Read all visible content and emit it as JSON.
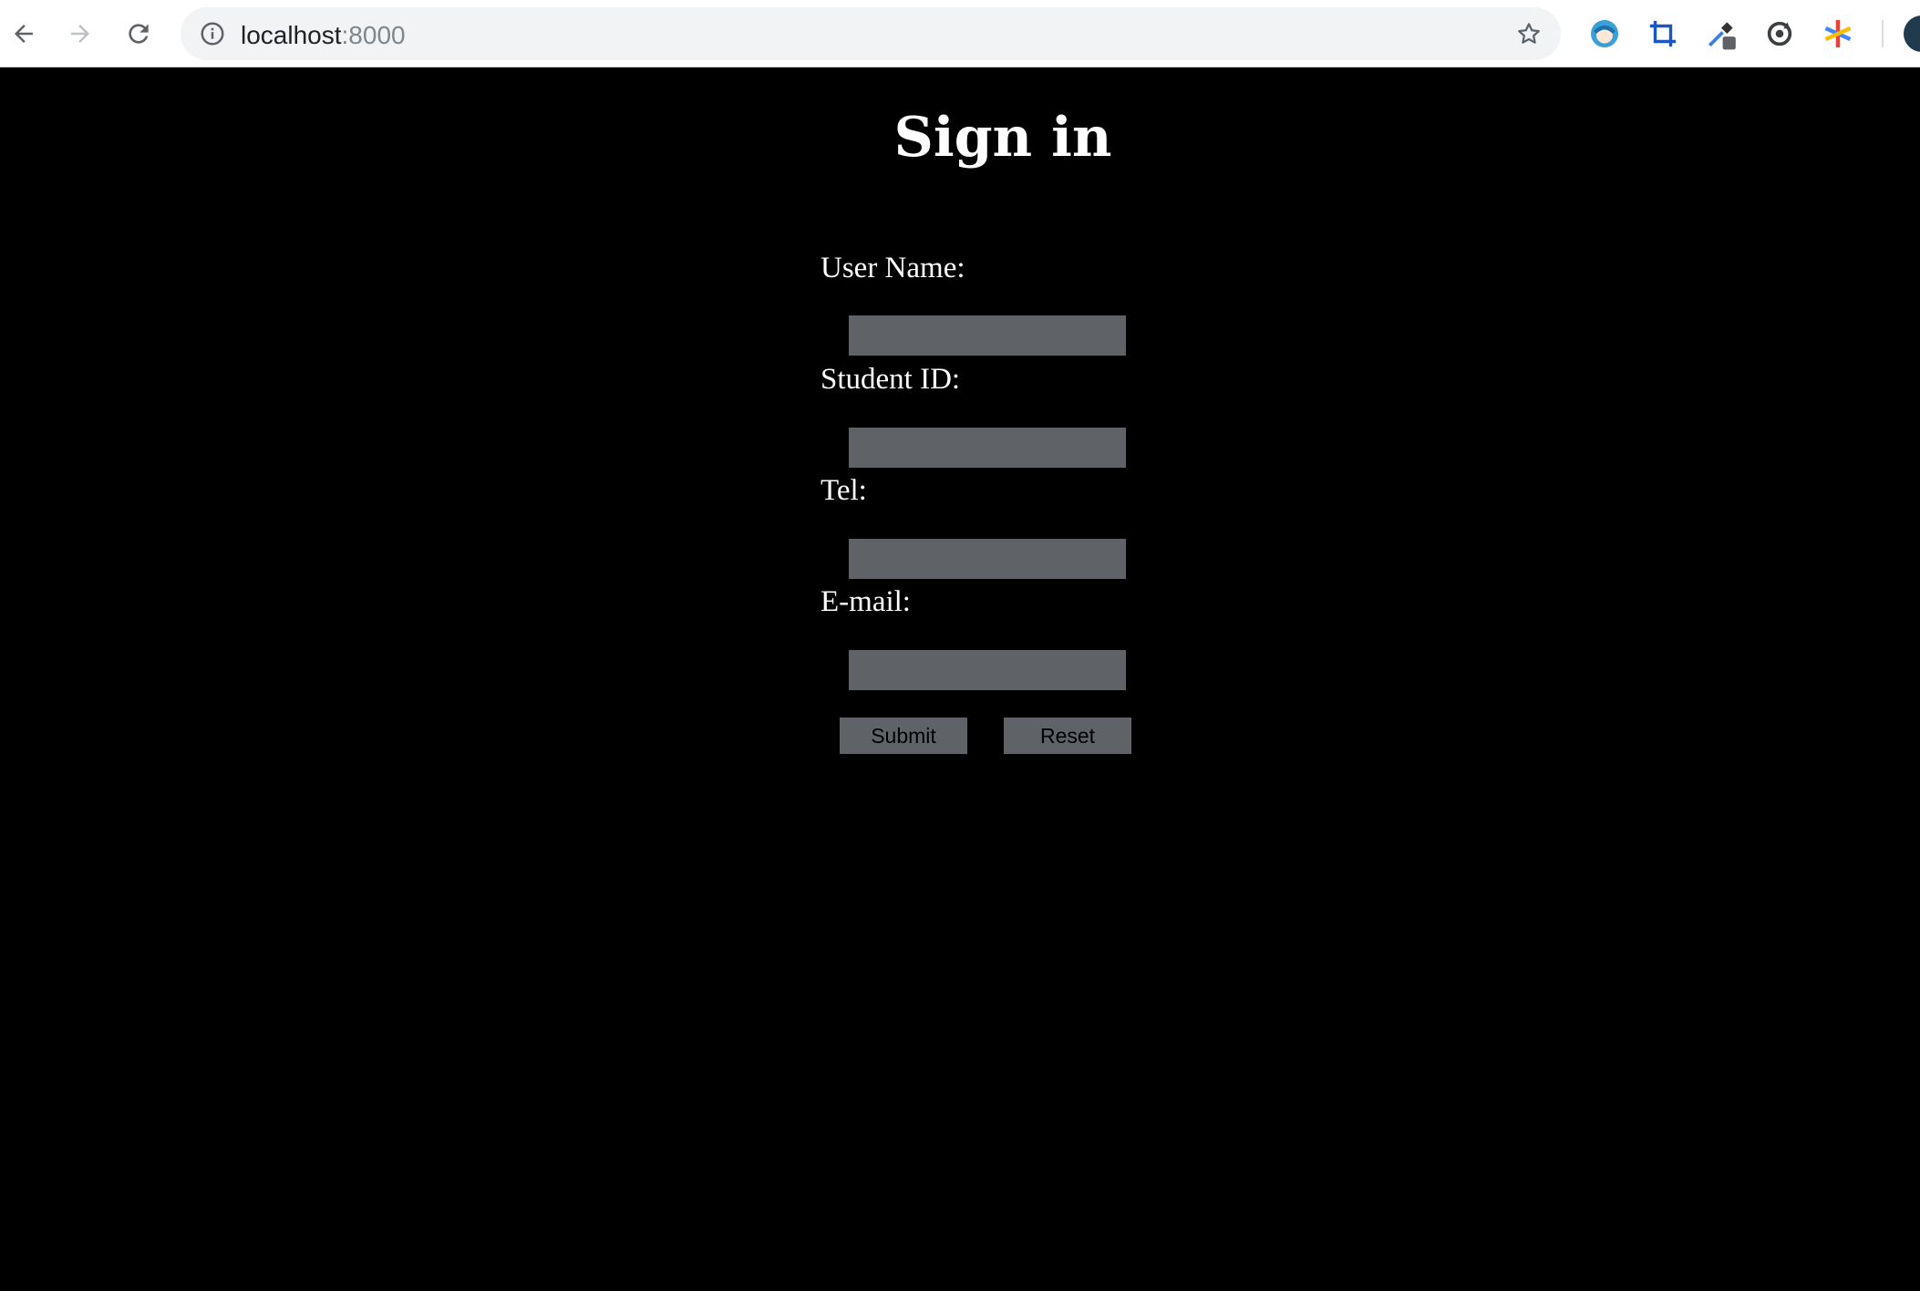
{
  "browser": {
    "url_host": "localhost",
    "url_port": ":8000",
    "icons": {
      "back": "back-arrow-icon",
      "forward": "forward-arrow-icon",
      "reload": "reload-icon",
      "info": "info-icon",
      "bookmark": "star-icon"
    },
    "extensions": [
      "anime-girl-extension-icon",
      "crop-extension-icon",
      "eyedropper-extension-icon",
      "sync-extension-icon",
      "asterisk-extension-icon"
    ]
  },
  "form": {
    "title": "Sign in",
    "fields": [
      {
        "label": "User Name:",
        "value": ""
      },
      {
        "label": "Student ID:",
        "value": ""
      },
      {
        "label": "Tel:",
        "value": ""
      },
      {
        "label": "E-mail:",
        "value": ""
      }
    ],
    "submit_label": "Submit",
    "reset_label": "Reset"
  },
  "colors": {
    "page_background": "#000000",
    "input_background": "#5f6368",
    "text": "#ffffff"
  }
}
